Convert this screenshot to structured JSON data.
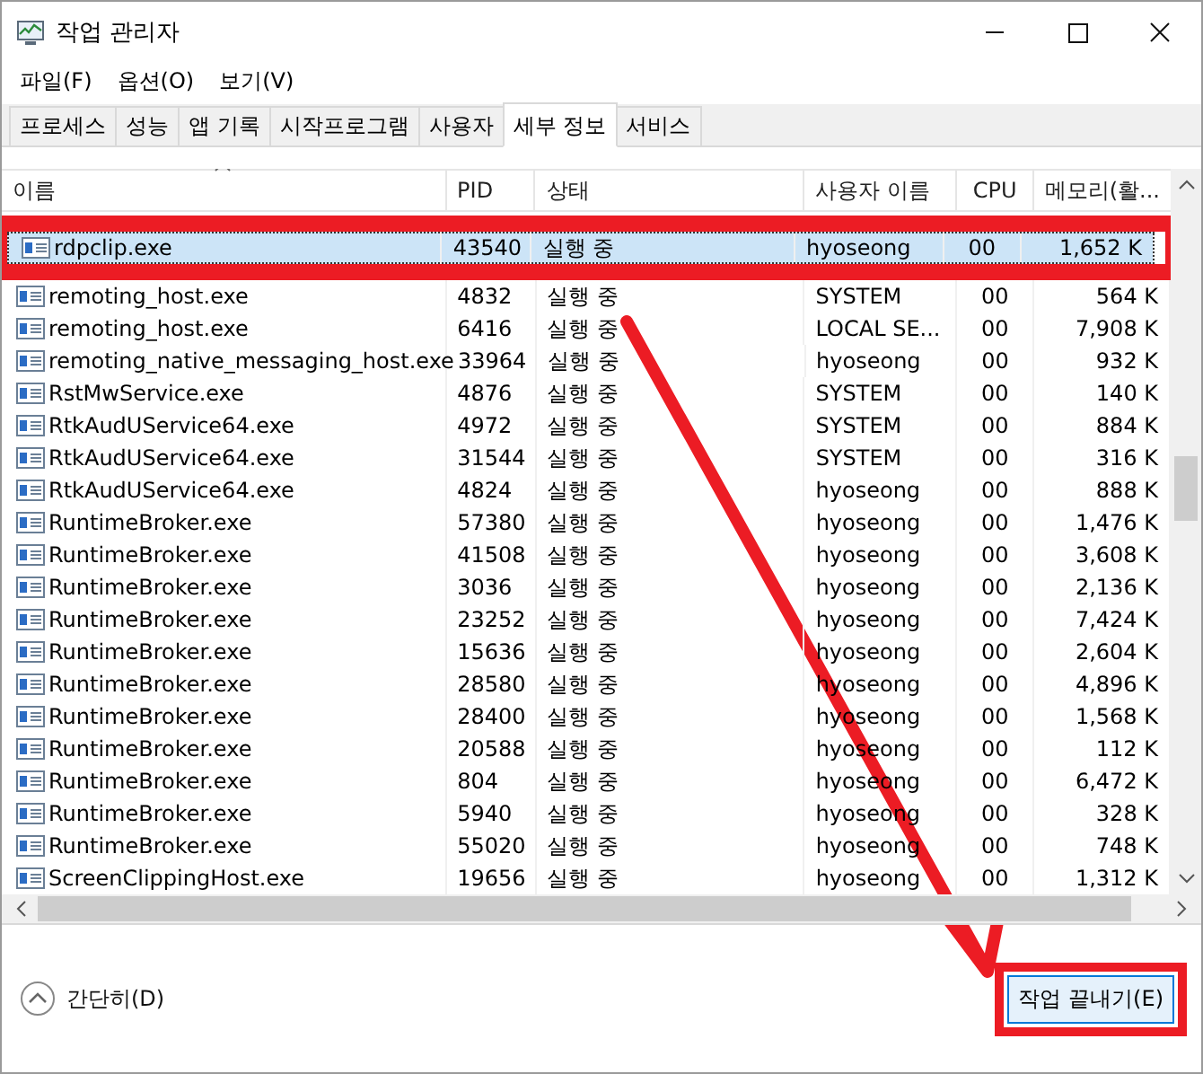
{
  "window": {
    "title": "작업 관리자"
  },
  "menu": [
    "파일(F)",
    "옵션(O)",
    "보기(V)"
  ],
  "tabs": [
    {
      "label": "프로세스",
      "selected": false
    },
    {
      "label": "성능",
      "selected": false
    },
    {
      "label": "앱 기록",
      "selected": false
    },
    {
      "label": "시작프로그램",
      "selected": false
    },
    {
      "label": "사용자",
      "selected": false
    },
    {
      "label": "세부 정보",
      "selected": true
    },
    {
      "label": "서비스",
      "selected": false
    }
  ],
  "table": {
    "columns": [
      "이름",
      "PID",
      "상태",
      "사용자 이름",
      "CPU",
      "메모리(활..."
    ],
    "rows": [
      {
        "name": "rdpclip.exe",
        "pid": "43540",
        "status": "실행 중",
        "user": "hyoseong",
        "cpu": "00",
        "memory": "1,652 K",
        "selected": true,
        "highlighted": true
      },
      {
        "name": "remoting_host.exe",
        "pid": "4832",
        "status": "실행 중",
        "user": "SYSTEM",
        "cpu": "00",
        "memory": "564 K",
        "selected": false,
        "highlighted": false
      },
      {
        "name": "remoting_host.exe",
        "pid": "6416",
        "status": "실행 중",
        "user": "LOCAL SE...",
        "cpu": "00",
        "memory": "7,908 K",
        "selected": false,
        "highlighted": false
      },
      {
        "name": "remoting_native_messaging_host.exe",
        "pid": "33964",
        "status": "실행 중",
        "user": "hyoseong",
        "cpu": "00",
        "memory": "932 K",
        "selected": false,
        "highlighted": false
      },
      {
        "name": "RstMwService.exe",
        "pid": "4876",
        "status": "실행 중",
        "user": "SYSTEM",
        "cpu": "00",
        "memory": "140 K",
        "selected": false,
        "highlighted": false
      },
      {
        "name": "RtkAudUService64.exe",
        "pid": "4972",
        "status": "실행 중",
        "user": "SYSTEM",
        "cpu": "00",
        "memory": "884 K",
        "selected": false,
        "highlighted": false
      },
      {
        "name": "RtkAudUService64.exe",
        "pid": "31544",
        "status": "실행 중",
        "user": "SYSTEM",
        "cpu": "00",
        "memory": "316 K",
        "selected": false,
        "highlighted": false
      },
      {
        "name": "RtkAudUService64.exe",
        "pid": "4824",
        "status": "실행 중",
        "user": "hyoseong",
        "cpu": "00",
        "memory": "888 K",
        "selected": false,
        "highlighted": false
      },
      {
        "name": "RuntimeBroker.exe",
        "pid": "57380",
        "status": "실행 중",
        "user": "hyoseong",
        "cpu": "00",
        "memory": "1,476 K",
        "selected": false,
        "highlighted": false
      },
      {
        "name": "RuntimeBroker.exe",
        "pid": "41508",
        "status": "실행 중",
        "user": "hyoseong",
        "cpu": "00",
        "memory": "3,608 K",
        "selected": false,
        "highlighted": false
      },
      {
        "name": "RuntimeBroker.exe",
        "pid": "3036",
        "status": "실행 중",
        "user": "hyoseong",
        "cpu": "00",
        "memory": "2,136 K",
        "selected": false,
        "highlighted": false
      },
      {
        "name": "RuntimeBroker.exe",
        "pid": "23252",
        "status": "실행 중",
        "user": "hyoseong",
        "cpu": "00",
        "memory": "7,424 K",
        "selected": false,
        "highlighted": false
      },
      {
        "name": "RuntimeBroker.exe",
        "pid": "15636",
        "status": "실행 중",
        "user": "hyoseong",
        "cpu": "00",
        "memory": "2,604 K",
        "selected": false,
        "highlighted": false
      },
      {
        "name": "RuntimeBroker.exe",
        "pid": "28580",
        "status": "실행 중",
        "user": "hyoseong",
        "cpu": "00",
        "memory": "4,896 K",
        "selected": false,
        "highlighted": false
      },
      {
        "name": "RuntimeBroker.exe",
        "pid": "28400",
        "status": "실행 중",
        "user": "hyoseong",
        "cpu": "00",
        "memory": "1,568 K",
        "selected": false,
        "highlighted": false
      },
      {
        "name": "RuntimeBroker.exe",
        "pid": "20588",
        "status": "실행 중",
        "user": "hyoseong",
        "cpu": "00",
        "memory": "112 K",
        "selected": false,
        "highlighted": false
      },
      {
        "name": "RuntimeBroker.exe",
        "pid": "804",
        "status": "실행 중",
        "user": "hyoseong",
        "cpu": "00",
        "memory": "6,472 K",
        "selected": false,
        "highlighted": false
      },
      {
        "name": "RuntimeBroker.exe",
        "pid": "5940",
        "status": "실행 중",
        "user": "hyoseong",
        "cpu": "00",
        "memory": "328 K",
        "selected": false,
        "highlighted": false
      },
      {
        "name": "RuntimeBroker.exe",
        "pid": "55020",
        "status": "실행 중",
        "user": "hyoseong",
        "cpu": "00",
        "memory": "748 K",
        "selected": false,
        "highlighted": false
      },
      {
        "name": "ScreenClippingHost.exe",
        "pid": "19656",
        "status": "실행 중",
        "user": "hyoseong",
        "cpu": "00",
        "memory": "1,312 K",
        "selected": false,
        "highlighted": false
      }
    ]
  },
  "footer": {
    "collapse_link": "간단히(D)",
    "end_task_button": {
      "label": "작업 끝내기(E)",
      "highlighted": true
    }
  }
}
